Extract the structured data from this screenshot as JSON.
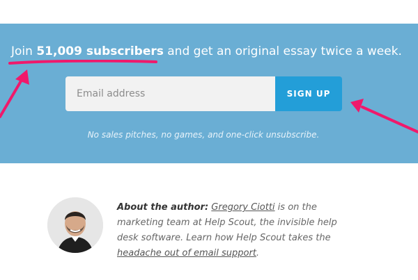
{
  "signup": {
    "headline_prefix": "Join ",
    "headline_count": "51,009 subscribers",
    "headline_suffix": " and get an original essay twice a week.",
    "email_placeholder": "Email address",
    "button_label": "SIGN UP",
    "fineprint": "No sales pitches, no games, and one-click unsubscribe."
  },
  "author": {
    "lead": "About the author:",
    "name": "Gregory Ciotti",
    "text1": " is on the marketing team at Help Scout, the invisible help desk software. Learn how Help Scout takes the ",
    "link": "headache out of email support",
    "text2": "."
  },
  "colors": {
    "banner": "#6aaed4",
    "button": "#239ed8",
    "annotation": "#f0196b"
  },
  "icons": [
    "annotation-arrow-icon",
    "annotation-underline-icon"
  ]
}
